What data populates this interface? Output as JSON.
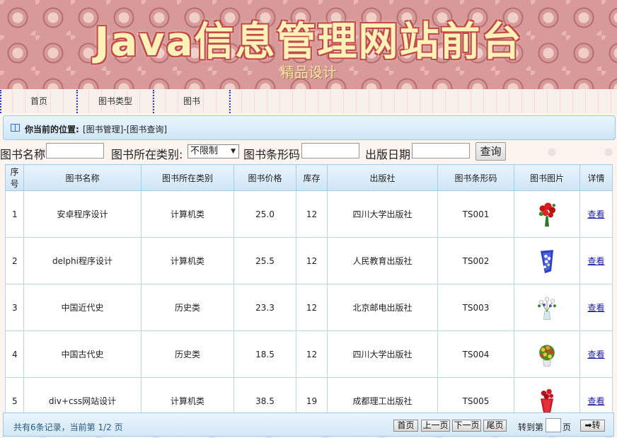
{
  "banner": {
    "title": "Java信息管理网站前台",
    "subtitle": "精品设计"
  },
  "nav": [
    "首页",
    "图书类型",
    "图书"
  ],
  "location": {
    "label": "你当前的位置:",
    "path": "[图书管理]-[图书查询]"
  },
  "search": {
    "name_label": "图书名称:",
    "name_value": "",
    "category_label": "图书所在类别:",
    "category_selected": "不限制",
    "barcode_label": "图书条形码:",
    "barcode_value": "",
    "date_label": "出版日期:",
    "date_value": "",
    "button": "查询"
  },
  "table": {
    "headers": [
      "序号",
      "图书名称",
      "图书所在类别",
      "图书价格",
      "库存",
      "出版社",
      "图书条形码",
      "图书图片",
      "详情"
    ],
    "rows": [
      {
        "seq": "1",
        "name": "安卓程序设计",
        "category": "计算机类",
        "price": "25.0",
        "stock": "12",
        "publisher": "四川大学出版社",
        "barcode": "TS001",
        "image_icon": "red-rose-bouquet-icon",
        "detail": "查看"
      },
      {
        "seq": "2",
        "name": "delphi程序设计",
        "category": "计算机类",
        "price": "25.5",
        "stock": "12",
        "publisher": "人民教育出版社",
        "barcode": "TS002",
        "image_icon": "blue-flower-bouquet-icon",
        "detail": "查看"
      },
      {
        "seq": "3",
        "name": "中国近代史",
        "category": "历史类",
        "price": "23.3",
        "stock": "12",
        "publisher": "北京邮电出版社",
        "barcode": "TS003",
        "image_icon": "white-flowers-vase-icon",
        "detail": "查看"
      },
      {
        "seq": "4",
        "name": "中国古代史",
        "category": "历史类",
        "price": "18.5",
        "stock": "12",
        "publisher": "四川大学出版社",
        "barcode": "TS004",
        "image_icon": "yellow-flower-basket-icon",
        "detail": "查看"
      },
      {
        "seq": "5",
        "name": "div+css网站设计",
        "category": "计算机类",
        "price": "38.5",
        "stock": "19",
        "publisher": "成都理工出版社",
        "barcode": "TS005",
        "image_icon": "red-rose-wrapped-icon",
        "detail": "查看"
      }
    ]
  },
  "footer": {
    "info": "共有6条记录，当前第 1/2 页",
    "first": "首页",
    "prev": "上一页",
    "next": "下一页",
    "last": "尾页",
    "goto_label": "转到第",
    "page_unit": "页",
    "go_button": "➡转"
  }
}
